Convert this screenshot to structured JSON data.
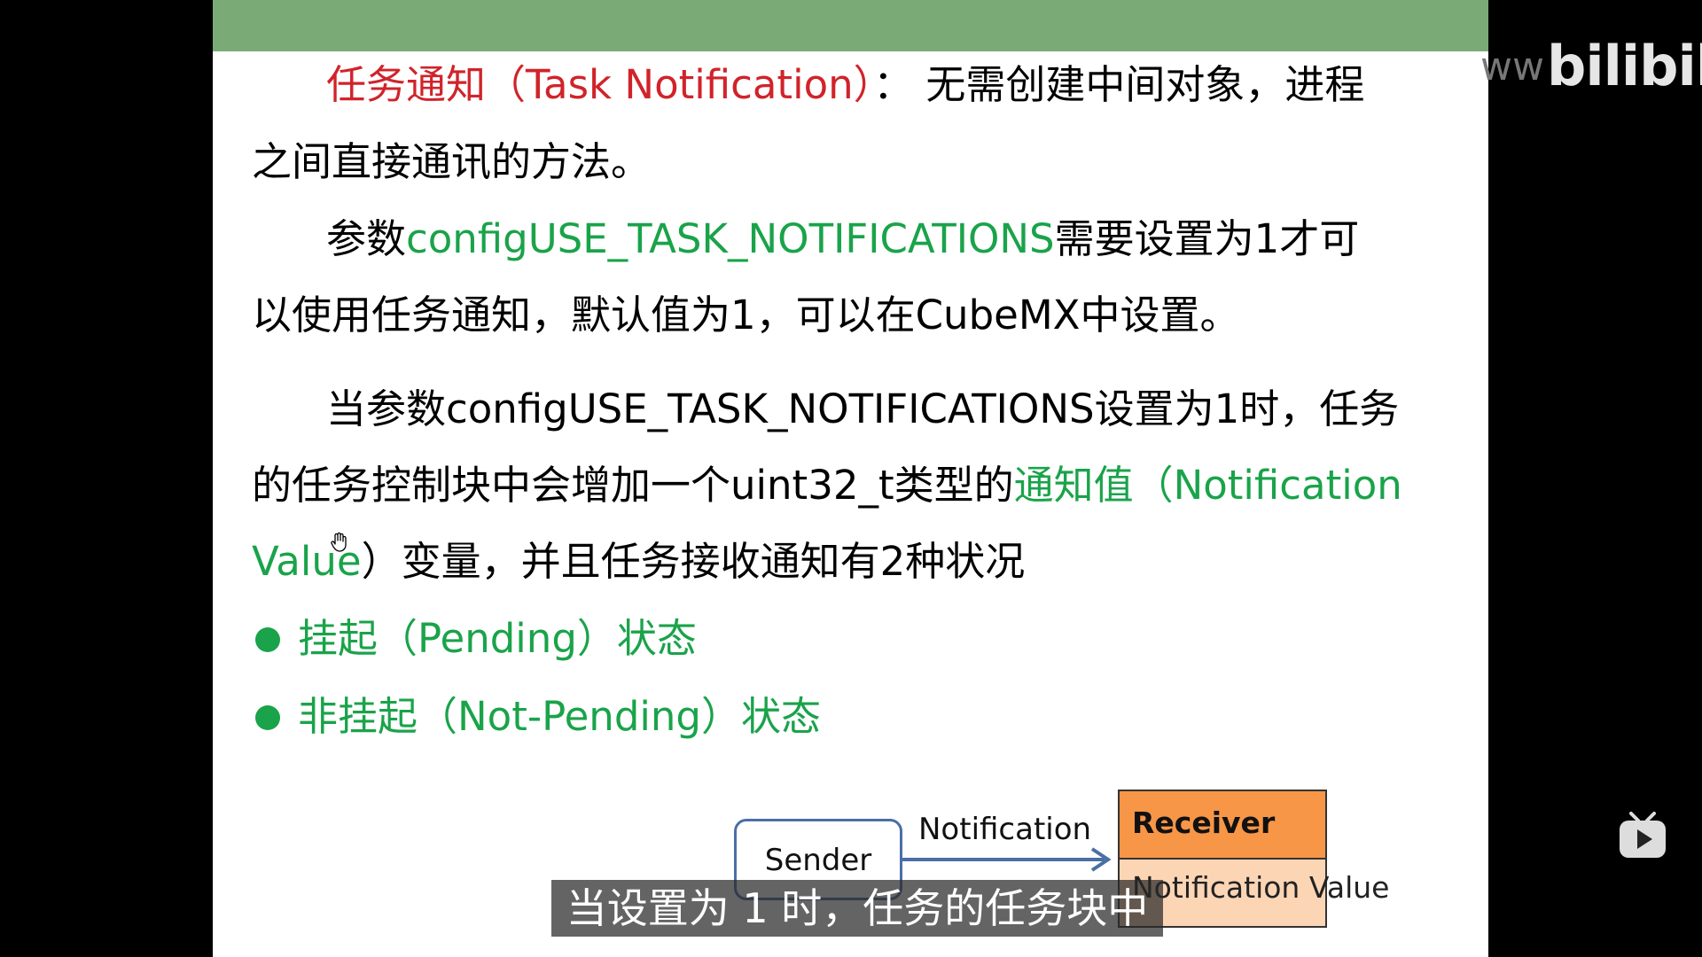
{
  "slide": {
    "line1": {
      "red": "任务通知（Task Notification）",
      "black": "： 无需创建中间对象，进程"
    },
    "line2": "之间直接通讯的方法。",
    "line3": {
      "a": "参数",
      "green": "configUSE_TASK_NOTIFICATIONS",
      "b": "需要设置为1才可"
    },
    "line4": "以使用任务通知，默认值为1，可以在CubeMX中设置。",
    "line5": "当参数configUSE_TASK_NOTIFICATIONS设置为1时，任务",
    "line6": {
      "a": "的任务控制块中会增加一个uint32_t类型的",
      "green": "通知值（Notification"
    },
    "line7": {
      "green": "Value",
      "b": "）变量，并且任务接收通知有2种状况"
    },
    "bullets": [
      "挂起（Pending）状态",
      "非挂起（Not-Pending）状态"
    ],
    "diagram": {
      "sender": "Sender",
      "arrow_label": "Notification",
      "receiver_title": "Receiver",
      "receiver_field": "Notification Value"
    }
  },
  "subtitle": "当设置为 1 时，任务的任务块中",
  "watermark": {
    "prefix": "ww",
    "logo": "bilibili"
  },
  "colors": {
    "red": "#d1232a",
    "green": "#1aa34a",
    "topbar": "#7aab77",
    "receiver": "#f79646"
  },
  "icons": [
    "hand-cursor-icon",
    "bilibili-tv-icon",
    "bullet-dot-icon"
  ]
}
